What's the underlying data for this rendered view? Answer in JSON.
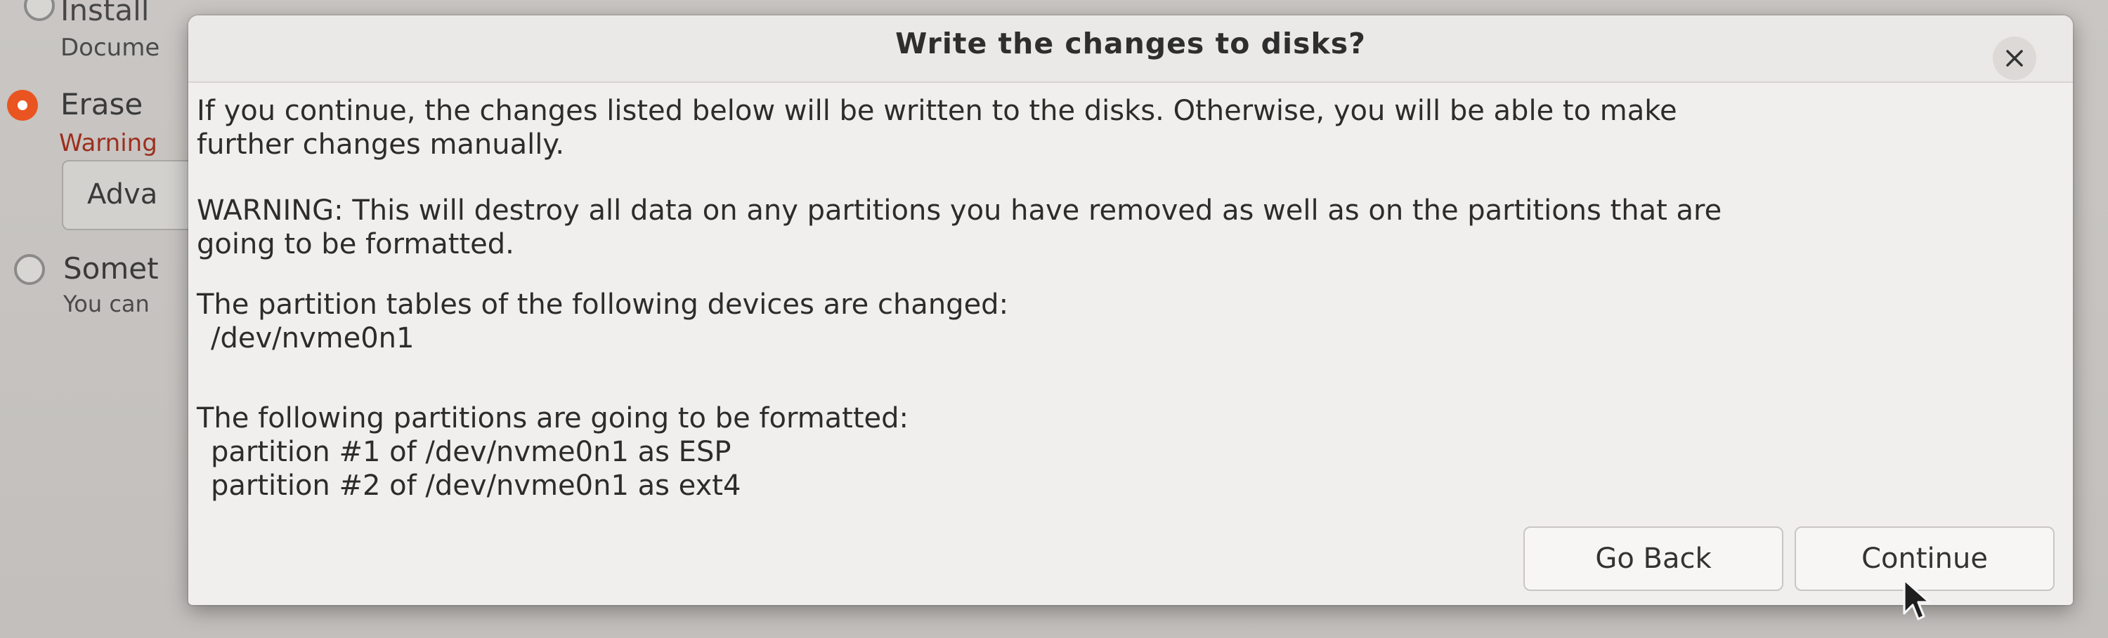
{
  "background": {
    "install_label": "Install",
    "documents_label": "Docume",
    "erase_label": "Erase",
    "warning_label": "Warning",
    "advanced_label": "Adva",
    "something_label": "Somet",
    "you_can_label": "You can"
  },
  "dialog": {
    "title": "Write the changes to disks?",
    "intro_line1": "If you continue, the changes listed below will be written to the disks. Otherwise, you will be able to make",
    "intro_line2": "further changes manually.",
    "warning_line1": "WARNING: This will destroy all data on any partitions you have removed as well as on the partitions that are",
    "warning_line2": "going to be formatted.",
    "partition_tables_heading": "The partition tables of the following devices are changed:",
    "changed_devices": [
      "/dev/nvme0n1"
    ],
    "formatted_heading": "The following partitions are going to be formatted:",
    "formatted_partitions": [
      "partition #1 of /dev/nvme0n1 as ESP",
      "partition #2 of /dev/nvme0n1 as ext4"
    ],
    "go_back_label": "Go Back",
    "continue_label": "Continue"
  },
  "colors": {
    "accent": "#e95420",
    "dialog_bg": "#f1efed",
    "background": "#c4c1be"
  },
  "icons": {
    "close": "close-icon",
    "cursor": "mouse-pointer-icon"
  }
}
